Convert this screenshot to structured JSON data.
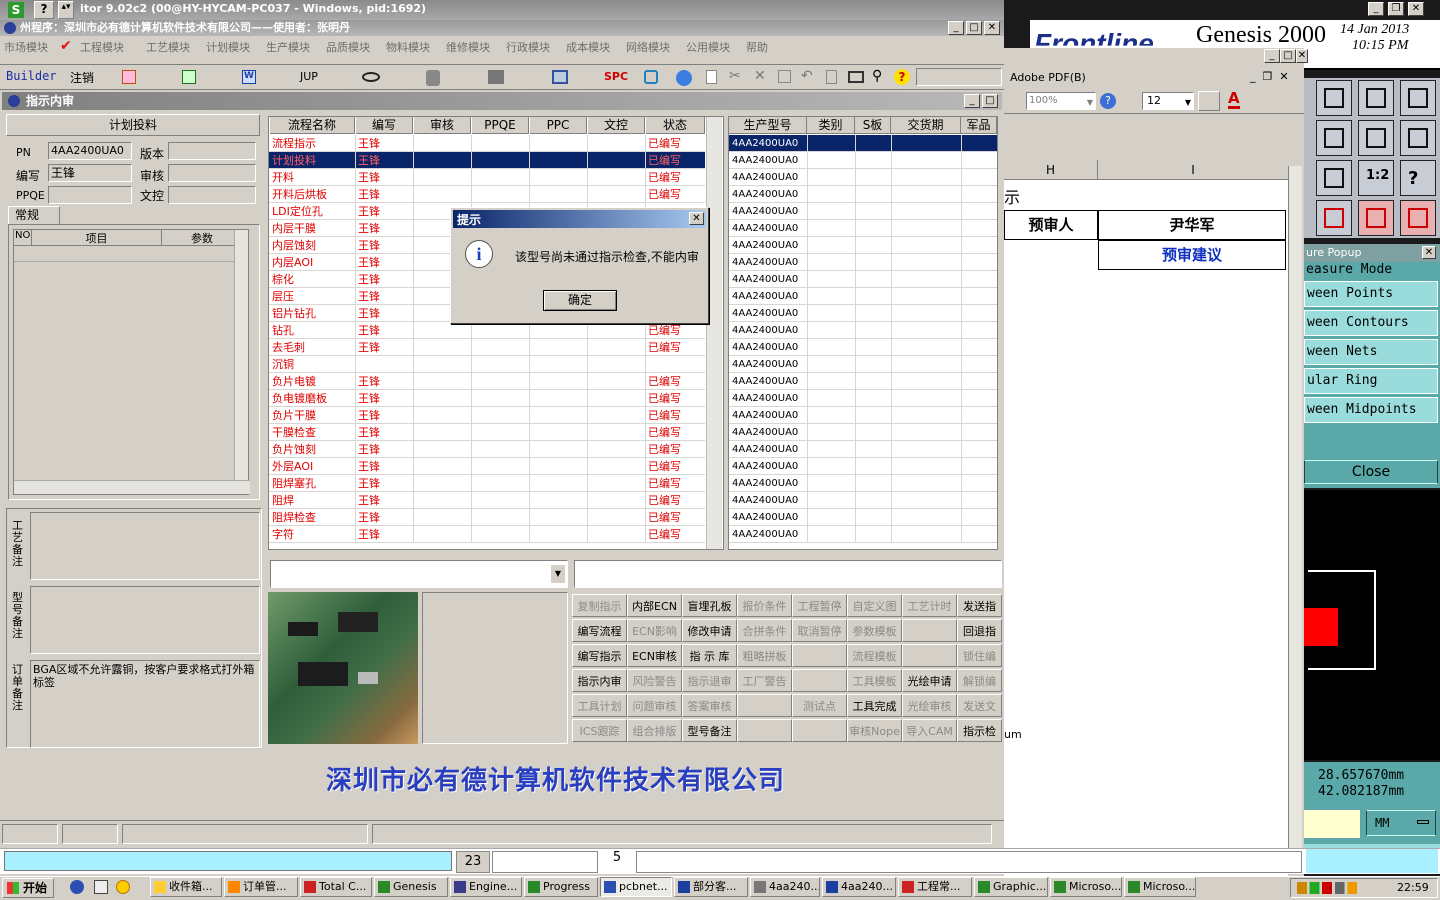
{
  "main_window": {
    "title": "itor 9.02c2 (00@HY-HYCAM-PC037 - Windows, pid:1692)",
    "subtitle": "州程序：深圳市必有德计算机软件技术有限公司——使用者：张明丹",
    "menu": [
      "市场模块",
      "工程模块",
      "工艺模块",
      "计划模块",
      "生产模块",
      "品质模块",
      "物料模块",
      "维修模块",
      "行政模块",
      "成本模块",
      "网络模块",
      "公用模块",
      "帮助"
    ],
    "toolbar": {
      "builder": "Builder",
      "logout": "注销",
      "jup": "JUP",
      "spc": "SPC"
    }
  },
  "inner_window": {
    "title": "指示内审"
  },
  "left_panel": {
    "header": "计划投料",
    "fields": {
      "pn_label": "PN",
      "pn_value": "4AA2400UA0",
      "version_label": "版本",
      "version_value": "",
      "author_label": "编写",
      "author_value": "王锋",
      "review_label": "审核",
      "review_value": "",
      "ppqe_label": "PPQE",
      "ppqe_value": "",
      "doc_label": "文控",
      "doc_value": ""
    },
    "tab": "常规",
    "param_headers": [
      "NO",
      "项目",
      "参数"
    ],
    "notes": {
      "process_label": "工艺备注",
      "model_label": "型号备注",
      "order_label": "订单备注",
      "order_text": "BGA区域不允许露铜，按客户要求格式打外箱标签"
    }
  },
  "flow_table": {
    "headers": [
      "流程名称",
      "编写",
      "审核",
      "PPQE",
      "PPC",
      "文控",
      "状态"
    ],
    "rows": [
      {
        "name": "流程指示",
        "author": "王锋",
        "status": "已编写"
      },
      {
        "name": "计划投料",
        "author": "王锋",
        "status": "已编写",
        "selected": true
      },
      {
        "name": "开料",
        "author": "王锋",
        "status": "已编写"
      },
      {
        "name": "开料后烘板",
        "author": "王锋",
        "status": "已编写"
      },
      {
        "name": "LDI定位孔",
        "author": "王锋",
        "status": ""
      },
      {
        "name": "内层干膜",
        "author": "王锋",
        "status": ""
      },
      {
        "name": "内层蚀刻",
        "author": "王锋",
        "status": ""
      },
      {
        "name": "内层AOI",
        "author": "王锋",
        "status": ""
      },
      {
        "name": "棕化",
        "author": "王锋",
        "status": ""
      },
      {
        "name": "层压",
        "author": "王锋",
        "status": ""
      },
      {
        "name": "铝片钻孔",
        "author": "王锋",
        "status": ""
      },
      {
        "name": "钻孔",
        "author": "王锋",
        "status": "已编写"
      },
      {
        "name": "去毛刺",
        "author": "王锋",
        "status": "已编写"
      },
      {
        "name": "沉铜",
        "author": "",
        "status": ""
      },
      {
        "name": "负片电镀",
        "author": "王锋",
        "status": "已编写"
      },
      {
        "name": "负电镀磨板",
        "author": "王锋",
        "status": "已编写"
      },
      {
        "name": "负片干膜",
        "author": "王锋",
        "status": "已编写"
      },
      {
        "name": "干膜检查",
        "author": "王锋",
        "status": "已编写"
      },
      {
        "name": "负片蚀刻",
        "author": "王锋",
        "status": "已编写"
      },
      {
        "name": "外层AOI",
        "author": "王锋",
        "status": "已编写"
      },
      {
        "name": "阻焊塞孔",
        "author": "王锋",
        "status": "已编写"
      },
      {
        "name": "阻焊",
        "author": "王锋",
        "status": "已编写"
      },
      {
        "name": "阻焊检查",
        "author": "王锋",
        "status": "已编写"
      },
      {
        "name": "字符",
        "author": "王锋",
        "status": "已编写"
      }
    ]
  },
  "model_table": {
    "headers": [
      "生产型号",
      "类别",
      "S板",
      "交货期",
      "军品"
    ],
    "model_value": "4AA2400UA0",
    "row_count": 24
  },
  "buttons": [
    [
      {
        "l": "复制指示",
        "d": true
      },
      {
        "l": "内部ECN",
        "d": false
      },
      {
        "l": "盲埋孔板",
        "d": false
      },
      {
        "l": "报价条件",
        "d": true
      },
      {
        "l": "工程暂停",
        "d": true
      },
      {
        "l": "自定义图",
        "d": true
      },
      {
        "l": "工艺计时",
        "d": true
      },
      {
        "l": "发送指",
        "d": false
      }
    ],
    [
      {
        "l": "编写流程",
        "d": false
      },
      {
        "l": "ECN影响",
        "d": true
      },
      {
        "l": "修改申请",
        "d": false
      },
      {
        "l": "合拼条件",
        "d": true
      },
      {
        "l": "取消暂停",
        "d": true
      },
      {
        "l": "参数模板",
        "d": true
      },
      {
        "l": "",
        "d": true
      },
      {
        "l": "回退指",
        "d": false
      }
    ],
    [
      {
        "l": "编写指示",
        "d": false
      },
      {
        "l": "ECN审核",
        "d": false
      },
      {
        "l": "指 示 库",
        "d": false
      },
      {
        "l": "粗略拼板",
        "d": true
      },
      {
        "l": "",
        "d": true
      },
      {
        "l": "流程模板",
        "d": true
      },
      {
        "l": "",
        "d": true
      },
      {
        "l": "锁住编",
        "d": true
      }
    ],
    [
      {
        "l": "指示内审",
        "d": false
      },
      {
        "l": "风险警告",
        "d": true
      },
      {
        "l": "指示退审",
        "d": true
      },
      {
        "l": "工厂警告",
        "d": true
      },
      {
        "l": "",
        "d": true
      },
      {
        "l": "工具模板",
        "d": true
      },
      {
        "l": "光绘申请",
        "d": false
      },
      {
        "l": "解锁编",
        "d": true
      }
    ],
    [
      {
        "l": "工具计划",
        "d": true
      },
      {
        "l": "问题审核",
        "d": true
      },
      {
        "l": "答案审核",
        "d": true
      },
      {
        "l": "",
        "d": true
      },
      {
        "l": "测试点",
        "d": true
      },
      {
        "l": "工具完成",
        "d": false
      },
      {
        "l": "光绘审核",
        "d": true
      },
      {
        "l": "发送文",
        "d": true
      }
    ],
    [
      {
        "l": "ICS跟踪",
        "d": true
      },
      {
        "l": "组合排版",
        "d": true
      },
      {
        "l": "型号备注",
        "d": false
      },
      {
        "l": "",
        "d": true
      },
      {
        "l": "",
        "d": true
      },
      {
        "l": "审核Nope",
        "d": true
      },
      {
        "l": "导入CAM",
        "d": true
      },
      {
        "l": "指示检",
        "d": false
      }
    ]
  ],
  "company_banner": "深圳市必有德计算机软件技术有限公司",
  "dialog": {
    "title": "提示",
    "message": "该型号尚未通过指示检查,不能内审",
    "ok": "确定"
  },
  "pdf_window": {
    "title": "Adobe PDF(B)",
    "zoom": "100%",
    "font_size": "12",
    "col_h": "H",
    "col_i": "I",
    "cell_reviewer_label": "预审人",
    "cell_reviewer": "尹华军",
    "cell_suggestion": "预审建议",
    "partial_char": "示",
    "partial_um": "um"
  },
  "genesis": {
    "brand_partial": "Frontline",
    "title": "Genesis 2000",
    "date": "14 Jan 2013",
    "time": "10:15 PM",
    "popup_title": "ure Popup",
    "modes": [
      "easure Mode",
      "ween Points",
      "ween Contours",
      "ween Nets",
      "ular Ring",
      "ween Midpoints"
    ],
    "close": "Close",
    "x_readout": "28.657670mm",
    "y_readout": "42.082187mm",
    "unit": "MM"
  },
  "statusbar": {
    "num1": "23",
    "num2": "5"
  },
  "taskbar": {
    "start": "开始",
    "items": [
      "收件箱...",
      "订单管...",
      "Total C...",
      "Genesis",
      "Engine...",
      "Progress",
      "pcbnet...",
      "部分客...",
      "4aa240...",
      "4aa240...",
      "工程常...",
      "Graphic...",
      "Microso...",
      "Microso..."
    ],
    "clock": "22:59"
  },
  "colors": {
    "red_text": "#e00000",
    "selected_row": "#0a246a",
    "title_active": "#0a246a",
    "title_inactive": "#808080"
  }
}
